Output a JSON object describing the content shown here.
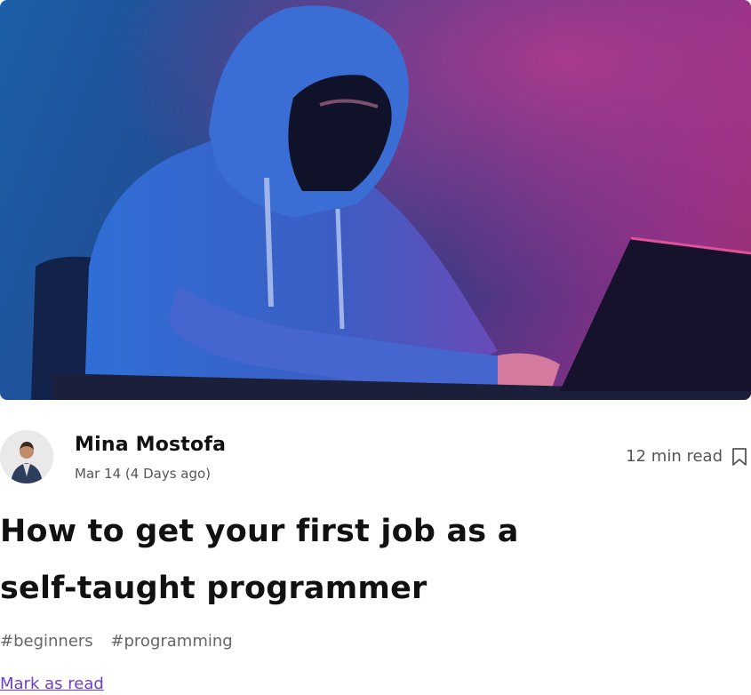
{
  "post": {
    "author_name": "Mina Mostofa",
    "date": "Mar 14 (4 Days ago)",
    "read_time": "12 min read",
    "title": "How to get your first job as a self-taught programmer",
    "tags": [
      "#beginners",
      "#programming"
    ],
    "mark_as_read": "Mark as read"
  },
  "icons": {
    "bookmark": "bookmark-icon"
  },
  "colors": {
    "link": "#6a3fd8",
    "title": "#111111",
    "muted": "#555555"
  }
}
